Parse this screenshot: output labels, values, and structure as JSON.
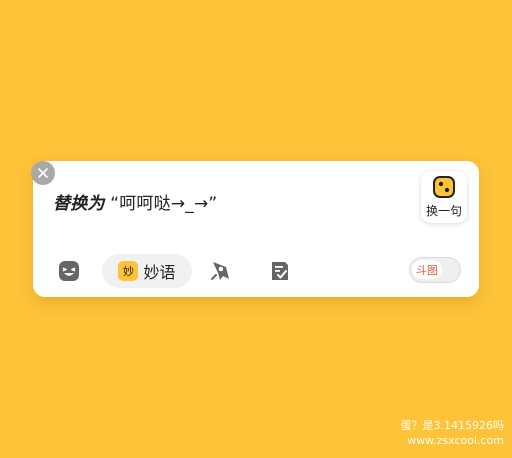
{
  "replace": {
    "prefix": "替换为",
    "text": " “呵呵哒→_→”"
  },
  "swap_button": {
    "label": "换一句",
    "icon": "dice-icon"
  },
  "toolbar": {
    "emoji_icon": "emoji-icon",
    "miaoyu": {
      "badge": "妙",
      "label": "妙语"
    },
    "rocket_icon": "rocket-icon",
    "note_icon": "checklist-note-icon",
    "toggle": {
      "label": "斗图",
      "state": "off"
    }
  },
  "watermark": {
    "line1": "蛋？是3.1415926吗",
    "line2": "www.zsxcool.com"
  },
  "colors": {
    "background": "#FEC338",
    "accent": "#FEC338",
    "toggle_text": "#E25A3B"
  }
}
